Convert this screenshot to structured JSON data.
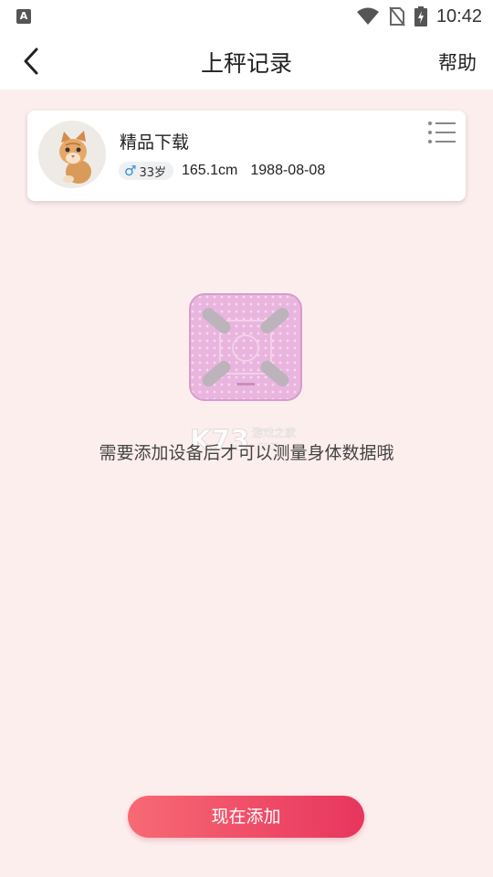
{
  "status_bar": {
    "time": "10:42",
    "left_icon": "A"
  },
  "header": {
    "title": "上秤记录",
    "help_label": "帮助"
  },
  "profile": {
    "name": "精品下载",
    "gender_symbol": "♂",
    "age": "33岁",
    "height": "165.1cm",
    "birthday": "1988-08-08"
  },
  "empty_state": {
    "message": "需要添加设备后才可以测量身体数据哦"
  },
  "watermark": {
    "brand": "K73",
    "sub_cn": "游戏之家",
    "sub_en": ".com"
  },
  "actions": {
    "add_now_label": "现在添加"
  },
  "colors": {
    "background": "#fdeeee",
    "button_start": "#f76a74",
    "button_end": "#e8355d",
    "male": "#2f8fd8"
  }
}
